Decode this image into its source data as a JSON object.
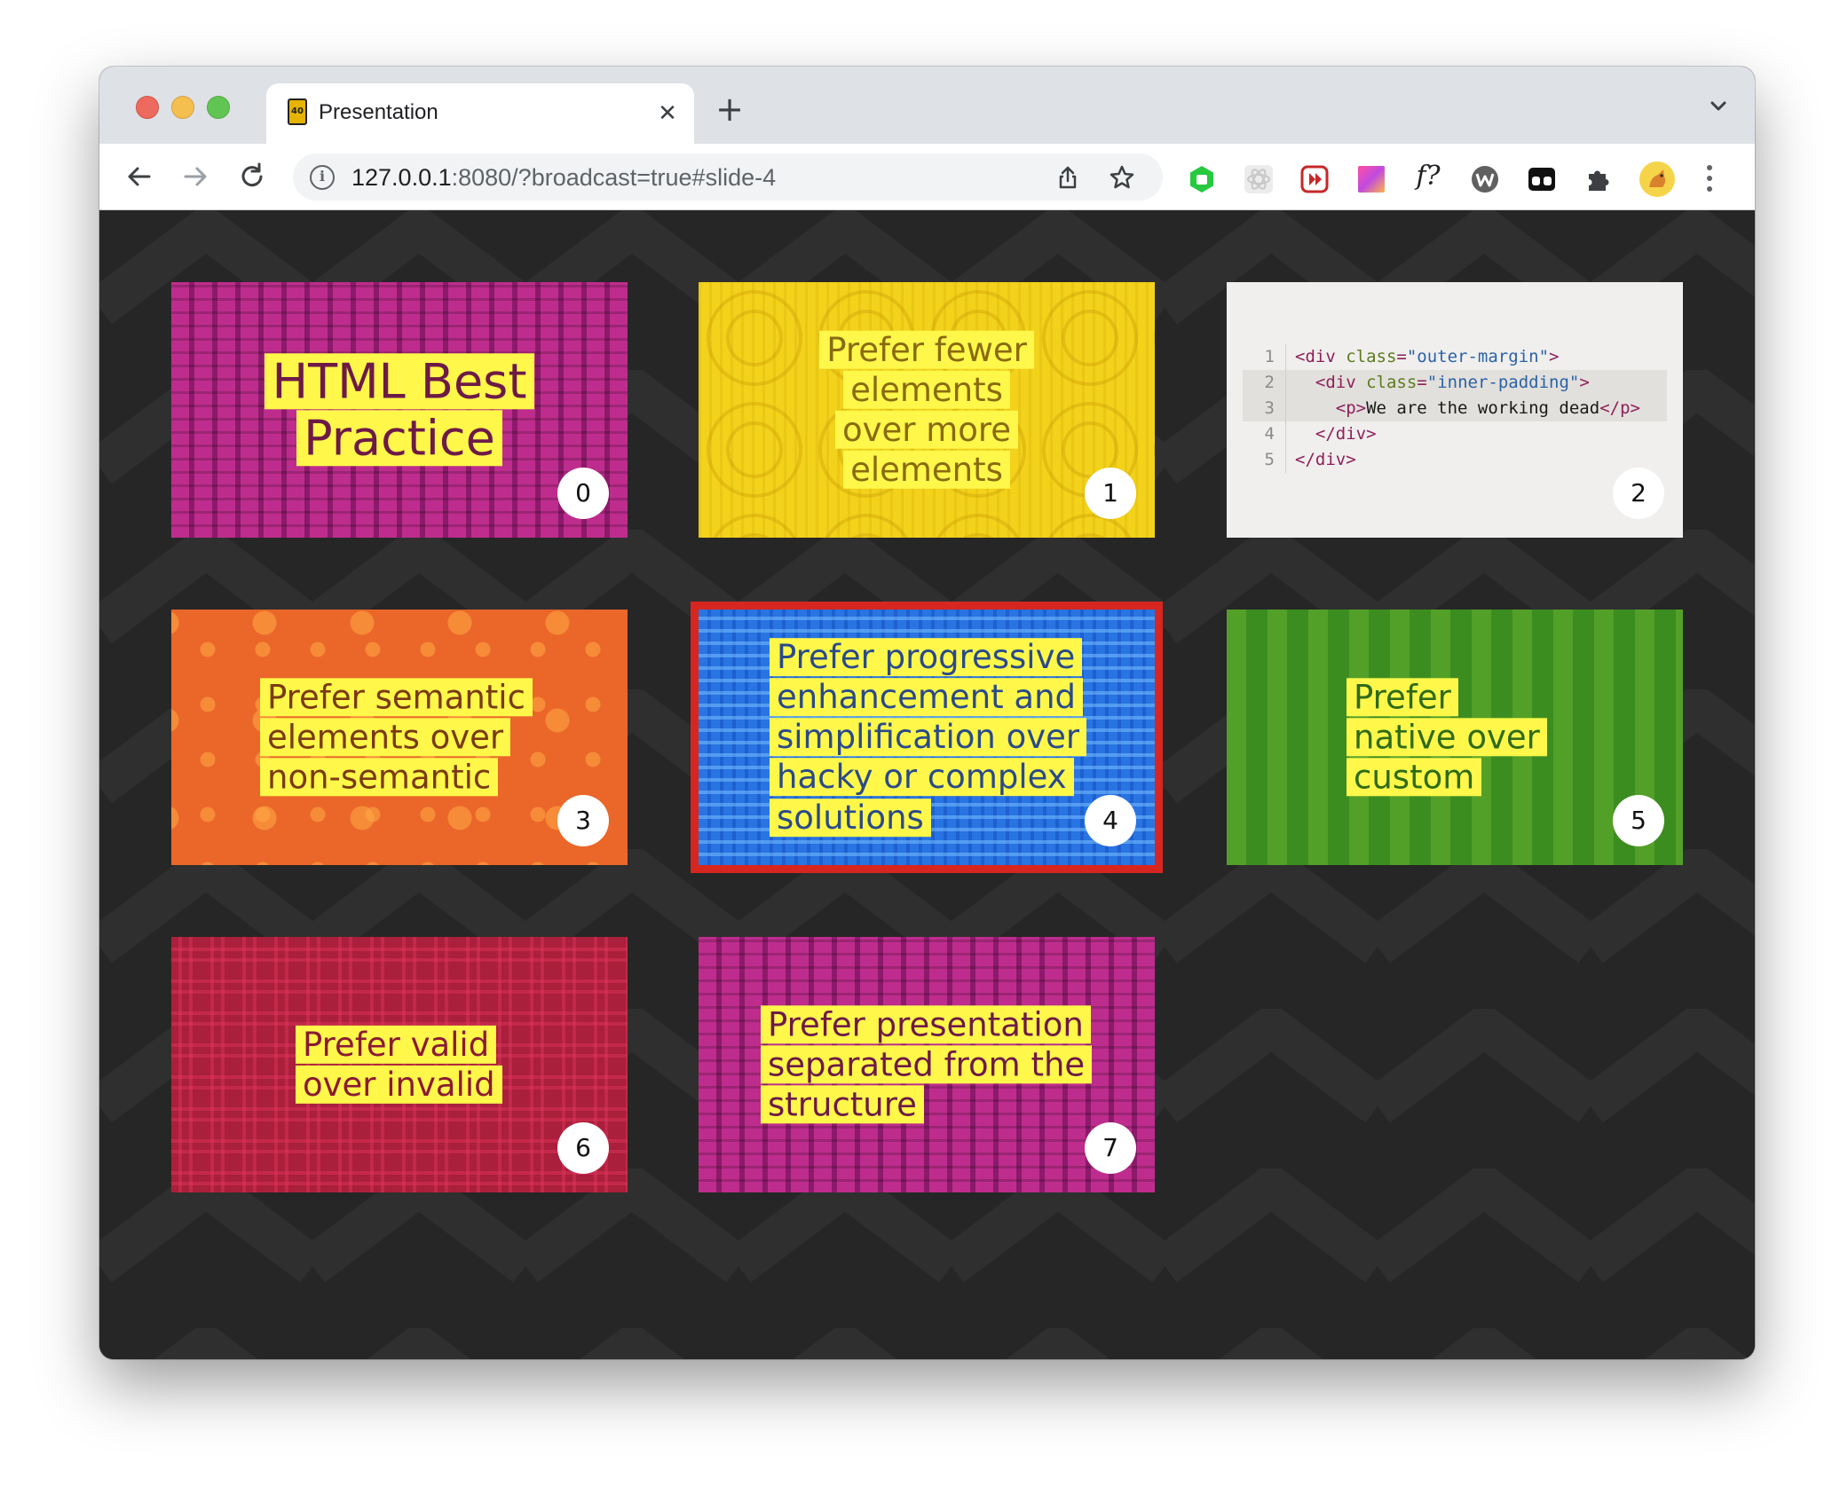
{
  "browser": {
    "tab": {
      "title": "Presentation",
      "favicon_text": "40"
    },
    "omnibox": {
      "host": "127.0.0.1",
      "rest": ":8080/?broadcast=true#slide-4"
    },
    "icons": [
      "back-arrow-icon",
      "forward-arrow-icon",
      "reload-icon",
      "site-info-icon",
      "share-icon",
      "star-icon",
      "extensions-puzzle-icon",
      "kebab-menu-icon"
    ],
    "extensions": {
      "fx_label": "f?"
    }
  },
  "slides": [
    {
      "number": "0",
      "title": "HTML Best Practice",
      "pattern": "brick-magenta",
      "color": "#8c1a6a"
    },
    {
      "number": "1",
      "title": "Prefer fewer elements over more elements",
      "pattern": "circles-yellow",
      "color": "#f2d21b"
    },
    {
      "number": "2",
      "title": "",
      "pattern": "code",
      "color": "#f0efed"
    },
    {
      "number": "3",
      "title": "Prefer semantic elements over non-semantic",
      "pattern": "dots-orange",
      "color": "#ea6629"
    },
    {
      "number": "4",
      "title": "Prefer progressive enhancement and simplification over hacky or complex solutions",
      "pattern": "greek-blue",
      "color": "#2974e3",
      "active": true
    },
    {
      "number": "5",
      "title": "Prefer native over custom",
      "pattern": "pills-green",
      "color": "#3c8d20"
    },
    {
      "number": "6",
      "title": "Prefer valid over invalid",
      "pattern": "squares-red",
      "color": "#aa1f3b"
    },
    {
      "number": "7",
      "title": "Prefer presentation separated from the structure",
      "pattern": "brick-magenta",
      "color": "#8c1a6a"
    }
  ],
  "code_slide": {
    "lines": [
      {
        "n": "1",
        "parts": [
          [
            "tg",
            "<div "
          ],
          [
            "at",
            "class"
          ],
          [
            "tg",
            "="
          ],
          [
            "st",
            "\"outer-margin\""
          ],
          [
            "tg",
            ">"
          ]
        ]
      },
      {
        "n": "2",
        "parts": [
          [
            "",
            "  "
          ],
          [
            "tg",
            "<div "
          ],
          [
            "at",
            "class"
          ],
          [
            "tg",
            "="
          ],
          [
            "st",
            "\"inner-padding\""
          ],
          [
            "tg",
            ">"
          ]
        ],
        "highlight": true
      },
      {
        "n": "3",
        "parts": [
          [
            "",
            "    "
          ],
          [
            "tg",
            "<p>"
          ],
          [
            "",
            "We are the working dead"
          ],
          [
            "tg",
            "</p>"
          ]
        ],
        "highlight": true
      },
      {
        "n": "4",
        "parts": [
          [
            "",
            "  "
          ],
          [
            "tg",
            "</div>"
          ]
        ]
      },
      {
        "n": "5",
        "parts": [
          [
            "tg",
            "</div>"
          ]
        ]
      }
    ]
  },
  "colors": {
    "background": "#262626",
    "active_outline": "#d7261f",
    "title_highlight": "#fff84a",
    "title_text": "#6b3c16"
  }
}
